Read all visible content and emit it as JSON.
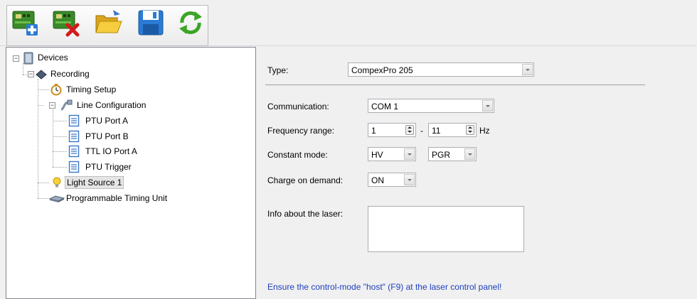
{
  "toolbar": {
    "buttons": [
      {
        "name": "add-device-button",
        "icon": "add-device-icon"
      },
      {
        "name": "remove-device-button",
        "icon": "remove-device-icon"
      },
      {
        "name": "open-button",
        "icon": "open-folder-icon"
      },
      {
        "name": "save-button",
        "icon": "save-icon"
      },
      {
        "name": "refresh-button",
        "icon": "refresh-icon"
      }
    ]
  },
  "tree": {
    "devices": "Devices",
    "recording": "Recording",
    "timing_setup": "Timing Setup",
    "line_configuration": "Line Configuration",
    "ptu_port_a": "PTU Port A",
    "ptu_port_b": "PTU Port B",
    "ttl_io_port_a": "TTL IO Port A",
    "ptu_trigger": "PTU Trigger",
    "light_source_1": "Light Source 1",
    "programmable_timing_unit": "Programmable Timing Unit"
  },
  "form": {
    "type_label": "Type:",
    "type_value": "CompexPro 205",
    "communication_label": "Communication:",
    "communication_value": "COM 1",
    "frequency_label": "Frequency range:",
    "frequency_min": "1",
    "frequency_sep": "-",
    "frequency_max": "11",
    "frequency_unit": "Hz",
    "constant_mode_label": "Constant mode:",
    "constant_mode_value": "HV",
    "constant_mode_value2": "PGR",
    "charge_label": "Charge on demand:",
    "charge_value": "ON",
    "info_label": "Info about the laser:",
    "info_value": "",
    "hint": "Ensure the control-mode \"host\" (F9) at the laser control panel!"
  },
  "colors": {
    "hint": "#1c3fbe",
    "selected_bg": "#e5e5e5",
    "tree_border": "#828790"
  }
}
